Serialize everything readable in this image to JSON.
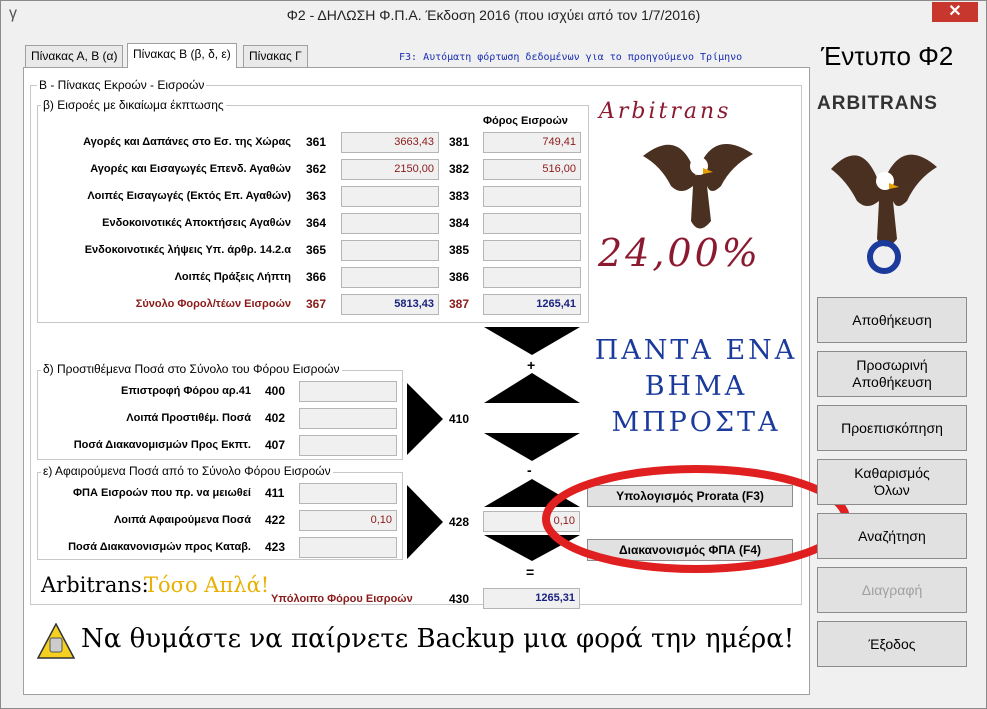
{
  "window": {
    "title": "Φ2 - ΔΗΛΩΣΗ Φ.Π.Α. Έκδοση 2016 (που ισχύει από τον 1/7/2016)",
    "close": "✕",
    "app_icon": "γ"
  },
  "tabs": [
    {
      "label": "Πίνακας Α, Β (α)"
    },
    {
      "label": "Πίνακας Β (β, δ, ε)"
    },
    {
      "label": "Πίνακας Γ"
    }
  ],
  "f3_hint": "F3: Αυτόματη φόρτωση δεδομένων για το προηγούμενο Τρίμηνο",
  "section_title": "Β - Πίνακας Εκροών - Εισροών",
  "group_b": {
    "title": "β) Εισροές με δικαίωμα έκπτωσης",
    "tax_header": "Φόρος Εισροών",
    "rows": [
      {
        "label": "Αγορές και Δαπάνες στο Εσ. της Χώρας",
        "code1": "361",
        "value1": "3663,43",
        "code2": "381",
        "value2": "749,41"
      },
      {
        "label": "Αγορές και Εισαγωγές Επενδ. Αγαθών",
        "code1": "362",
        "value1": "2150,00",
        "code2": "382",
        "value2": "516,00"
      },
      {
        "label": "Λοιπές Εισαγωγές (Εκτός Επ. Αγαθών)",
        "code1": "363",
        "value1": "",
        "code2": "383",
        "value2": ""
      },
      {
        "label": "Ενδοκοινοτικές Αποκτήσεις Αγαθών",
        "code1": "364",
        "value1": "",
        "code2": "384",
        "value2": ""
      },
      {
        "label": "Ενδοκοινοτικές λήψεις Υπ. άρθρ. 14.2.α",
        "code1": "365",
        "value1": "",
        "code2": "385",
        "value2": ""
      },
      {
        "label": "Λοιπές Πράξεις Λήπτη",
        "code1": "366",
        "value1": "",
        "code2": "386",
        "value2": ""
      }
    ],
    "total": {
      "label": "Σύνολο Φορολ/τέων Εισροών",
      "code1": "367",
      "value1": "5813,43",
      "code2": "387",
      "value2": "1265,41"
    }
  },
  "group_d": {
    "title": "δ) Προστιθέμενα Ποσά στο Σύνολο του Φόρου Εισροών",
    "rows": [
      {
        "label": "Επιστροφή Φόρου αρ.41",
        "code": "400",
        "value": ""
      },
      {
        "label": "Λοιπά Προστιθέμ. Ποσά",
        "code": "402",
        "value": ""
      },
      {
        "label": "Ποσά Διακανομισμών Προς Εκπτ.",
        "code": "407",
        "value": ""
      }
    ],
    "sum_code": "410",
    "sum_value": ""
  },
  "group_e": {
    "title": "ε) Αφαιρούμενα Ποσά από το Σύνολο Φόρου Εισροών",
    "rows": [
      {
        "label": "ΦΠΑ Εισροών που πρ. να μειωθεί",
        "code": "411",
        "value": ""
      },
      {
        "label": "Λοιπά Αφαιρούμενα Ποσά",
        "code": "422",
        "value": "0,10"
      },
      {
        "label": "Ποσά Διακανονισμών προς Καταβ.",
        "code": "423",
        "value": ""
      }
    ],
    "sum_code": "428",
    "sum_value": "0,10"
  },
  "symbols": {
    "plus": "+",
    "minus": "-",
    "equals": "="
  },
  "balance": {
    "label": "Υπόλοιπο Φόρου Εισροών",
    "code": "430",
    "value": "1265,31"
  },
  "calc_buttons": {
    "prorata": "Υπολογισμός Prorata (F3)",
    "settlement": "Διακανονισμός ΦΠΑ (F4)"
  },
  "promo": {
    "arbitrans_script": "Arbitrans",
    "rate": "24,00%",
    "motto_line1": "ΠΑΝΤΑ ΕΝΑ",
    "motto_line2": "ΒΗΜΑ",
    "motto_line3": "ΜΠΡΟΣΤΑ",
    "slogan_brand": "Arbitrans:",
    "slogan_text": "Τόσο Απλά!",
    "backup_reminder": "Να θυμάστε να παίρνετε Backup μια φορά την ημέρα!"
  },
  "side": {
    "form_title": "Έντυπο Φ2",
    "brand": "ARBITRANS",
    "buttons": {
      "save": "Αποθήκευση",
      "temp_save_1": "Προσωρινή",
      "temp_save_2": "Αποθήκευση",
      "preview": "Προεπισκόπηση",
      "clear_1": "Καθαρισμός",
      "clear_2": "Όλων",
      "search": "Αναζήτηση",
      "delete": "Διαγραφή",
      "exit": "Έξοδος"
    }
  },
  "colors": {
    "accent_red": "#8b1a1a",
    "total_blue": "#1a237e",
    "motto_blue": "#1a3a9c",
    "highlight_circle": "#e02020"
  }
}
